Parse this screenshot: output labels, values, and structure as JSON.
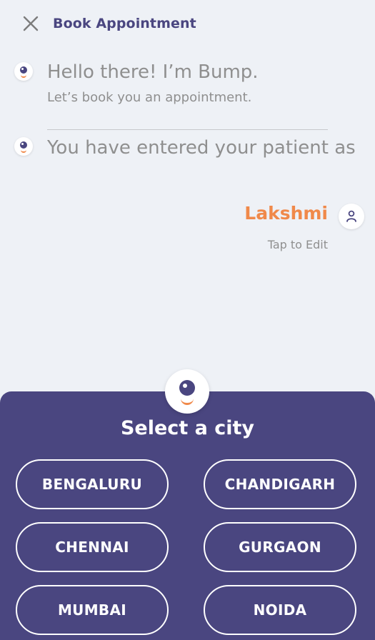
{
  "header": {
    "title": "Book Appointment",
    "close_icon": "close-icon"
  },
  "chat": {
    "greeting": "Hello there! I’m Bump.",
    "greeting_sub": "Let’s book you an appointment.",
    "patient_prompt": "You have entered your patient as",
    "patient_name": "Lakshmi",
    "tap_to_edit": "Tap to Edit"
  },
  "sheet": {
    "title": "Select a city",
    "cities": [
      "BENGALURU",
      "CHANDIGARH",
      "CHENNAI",
      "GURGAON",
      "MUMBAI",
      "NOIDA"
    ]
  },
  "colors": {
    "brand_purple": "#4a4680",
    "accent_orange": "#f0894a",
    "background": "#eef1f6"
  }
}
